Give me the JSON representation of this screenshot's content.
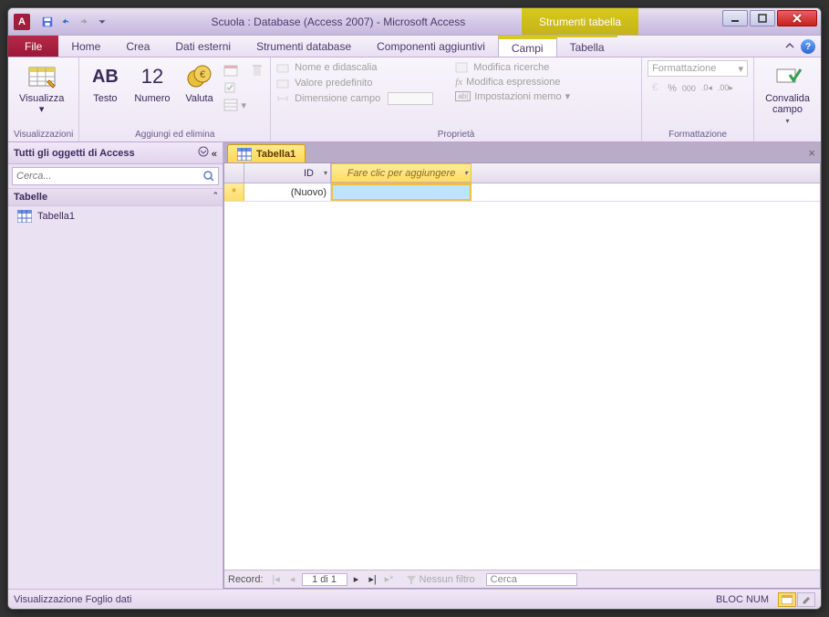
{
  "titlebar": {
    "app_letter": "A",
    "title": "Scuola : Database (Access 2007) - Microsoft Access",
    "context_title": "Strumenti tabella"
  },
  "menubar": {
    "file": "File",
    "tabs": [
      "Home",
      "Crea",
      "Dati esterni",
      "Strumenti database",
      "Componenti aggiuntivi"
    ],
    "context_tabs": [
      "Campi",
      "Tabella"
    ],
    "active_context": "Campi"
  },
  "ribbon": {
    "groups": {
      "visualizzazioni": {
        "label": "Visualizzazioni",
        "btn": "Visualizza"
      },
      "aggiungi": {
        "label": "Aggiungi ed elimina",
        "testo": "Testo",
        "numero": "Numero",
        "valuta": "Valuta",
        "testo_sample": "AB",
        "numero_sample": "12"
      },
      "proprieta": {
        "label": "Proprietà",
        "nome": "Nome e didascalia",
        "valore": "Valore predefinito",
        "dimensione": "Dimensione campo",
        "modifica_ricerche": "Modifica ricerche",
        "modifica_espressione": "Modifica espressione",
        "impostazioni_memo": "Impostazioni memo"
      },
      "formattazione": {
        "label": "Formattazione",
        "combo": "Formattazione"
      },
      "convalida": {
        "btn": "Convalida\ncampo"
      }
    }
  },
  "navpane": {
    "header": "Tutti gli oggetti di Access",
    "search_placeholder": "Cerca...",
    "group": "Tabelle",
    "items": [
      "Tabella1"
    ]
  },
  "doc": {
    "tab": "Tabella1",
    "col_id": "ID",
    "col_add": "Fare clic per aggiungere",
    "new_row": "(Nuovo)"
  },
  "recordnav": {
    "label": "Record:",
    "position": "1 di 1",
    "filter": "Nessun filtro",
    "search": "Cerca"
  },
  "statusbar": {
    "left": "Visualizzazione Foglio dati",
    "right": "BLOC NUM"
  }
}
